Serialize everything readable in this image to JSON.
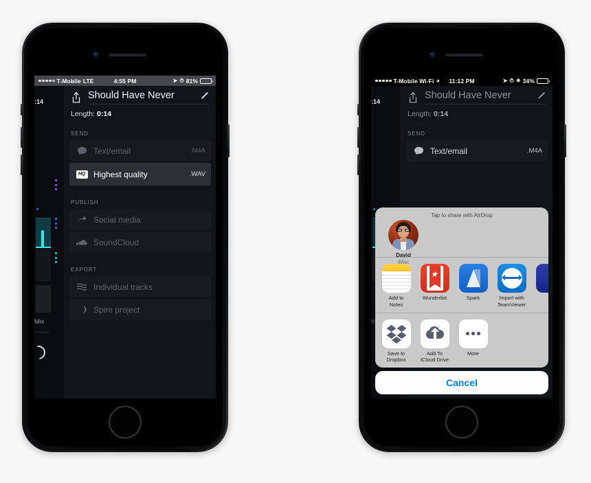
{
  "background_color": "#f7f7f7",
  "phones": [
    {
      "id": "left",
      "status_bar": {
        "carrier": "T-Mobile",
        "network": "LTE",
        "time": "4:55 PM",
        "battery_percent": "81%",
        "battery_level": 81,
        "battery_low_power": false,
        "signal_dots_filled": 4,
        "signal_dots_total": 5,
        "icons": [
          "location-arrow-icon",
          "alarm-icon"
        ],
        "style": "grey"
      },
      "strip": {
        "time": ":14",
        "mix_label": "Mix"
      },
      "header": {
        "share_icon": "share-icon",
        "title": "Should Have Never",
        "edit_icon": "pencil-icon"
      },
      "length_label": "Length:",
      "length_value": "0:14",
      "sections": [
        {
          "header": "SEND",
          "rows": [
            {
              "icon": "chat-bubble-icon",
              "label": "Text/email",
              "ext": ".M4A",
              "active": false
            },
            {
              "icon": "hq-badge-icon",
              "label": "Highest quality",
              "ext": ".WAV",
              "active": true
            }
          ]
        },
        {
          "header": "PUBLISH",
          "rows": [
            {
              "icon": "share-arrow-icon",
              "label": "Social media",
              "ext": "",
              "active": false
            },
            {
              "icon": "cloud-icon",
              "label": "SoundCloud",
              "ext": "",
              "active": false
            }
          ]
        },
        {
          "header": "EXPORT",
          "rows": [
            {
              "icon": "tracks-icon",
              "label": "Individual tracks",
              "ext": "",
              "active": false
            },
            {
              "icon": "spire-icon",
              "label": "Spire project",
              "ext": "",
              "active": false
            }
          ]
        }
      ],
      "share_sheet": null
    },
    {
      "id": "right",
      "status_bar": {
        "carrier": "T-Mobile Wi-Fi",
        "network": "wifi-icon",
        "time": "11:12 PM",
        "battery_percent": "34%",
        "battery_level": 34,
        "battery_low_power": true,
        "signal_dots_filled": 5,
        "signal_dots_total": 5,
        "icons": [
          "location-arrow-icon",
          "alarm-icon",
          "bluetooth-icon"
        ],
        "style": "black"
      },
      "strip": {
        "time": ":14",
        "mix_label": "Mix"
      },
      "header": {
        "share_icon": "share-icon",
        "title": "Should Have Never",
        "edit_icon": "pencil-icon"
      },
      "length_label": "Length:",
      "length_value": "0:14",
      "sections": [
        {
          "header": "SEND",
          "rows": [
            {
              "icon": "chat-bubble-icon",
              "label": "Text/email",
              "ext": ".M4A",
              "active": false
            }
          ]
        }
      ],
      "share_sheet": {
        "airdrop": {
          "hint": "Tap to share with AirDrop",
          "contacts": [
            {
              "name": "David",
              "device": "iMac",
              "avatar": "person-photo"
            }
          ]
        },
        "app_actions": [
          {
            "icon": "notes-icon",
            "label": "Add to Notes"
          },
          {
            "icon": "wunderlist-icon",
            "label": "Wunderlist"
          },
          {
            "icon": "spark-icon",
            "label": "Spark"
          },
          {
            "icon": "teamviewer-icon",
            "label": "Import with TeamViewer"
          },
          {
            "icon": "cutoff-icon",
            "label": "In"
          }
        ],
        "system_actions": [
          {
            "icon": "dropbox-icon",
            "label": "Save to Dropbox"
          },
          {
            "icon": "icloud-drive-icon",
            "label": "Add To iCloud Drive"
          },
          {
            "icon": "more-icon",
            "label": "More"
          }
        ],
        "cancel_label": "Cancel"
      }
    }
  ]
}
